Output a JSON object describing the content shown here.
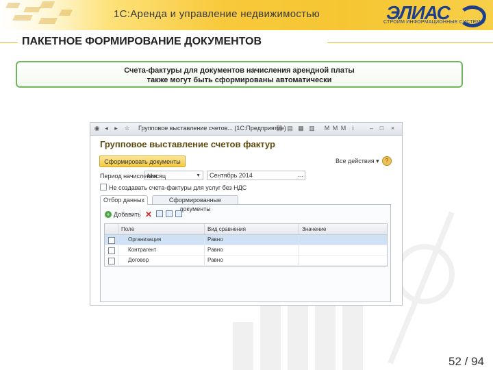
{
  "header": {
    "app_title": "1С:Аренда и управление недвижимостью",
    "brand_name": "ЭЛИАС",
    "brand_tagline": "СТРОИМ ИНФОРМАЦИОННЫЕ СИСТЕМЫ"
  },
  "slide": {
    "title": "ПАКЕТНОЕ ФОРМИРОВАНИЕ ДОКУМЕНТОВ",
    "note_line1": "Счета-фактуры для документов начисления арендной платы",
    "note_line2": "также могут быть сформированы автоматически",
    "page": "52 / 94"
  },
  "window": {
    "title": "Групповое выставление счетов... (1С:Предприятие)",
    "form_title": "Групповое выставление счетов фактур",
    "primary_button": "Сформировать документы",
    "all_actions": "Все действия ▾",
    "help": "?",
    "period_label": "Период начисления:",
    "period_value": "Месяц",
    "date_value": "Сентябрь 2014",
    "date_dots": "...",
    "checkbox_label": "Не создавать счета-фактуры для услуг без НДС",
    "tabs": [
      "Отбор данных",
      "Сформированные документы"
    ],
    "add_label": "Добавить",
    "columns": [
      "Поле",
      "Вид сравнения",
      "Значение"
    ],
    "rows": [
      {
        "field": "Организация",
        "comparison": "Равно",
        "value": ""
      },
      {
        "field": "Контрагент",
        "comparison": "Равно",
        "value": ""
      },
      {
        "field": "Договор",
        "comparison": "Равно",
        "value": ""
      }
    ]
  },
  "colors": {
    "accent_yellow": "#f6c632",
    "brand_blue": "#1e3f8c",
    "note_border_green": "#6fb65c",
    "selected_row": "#cfe2f5"
  }
}
